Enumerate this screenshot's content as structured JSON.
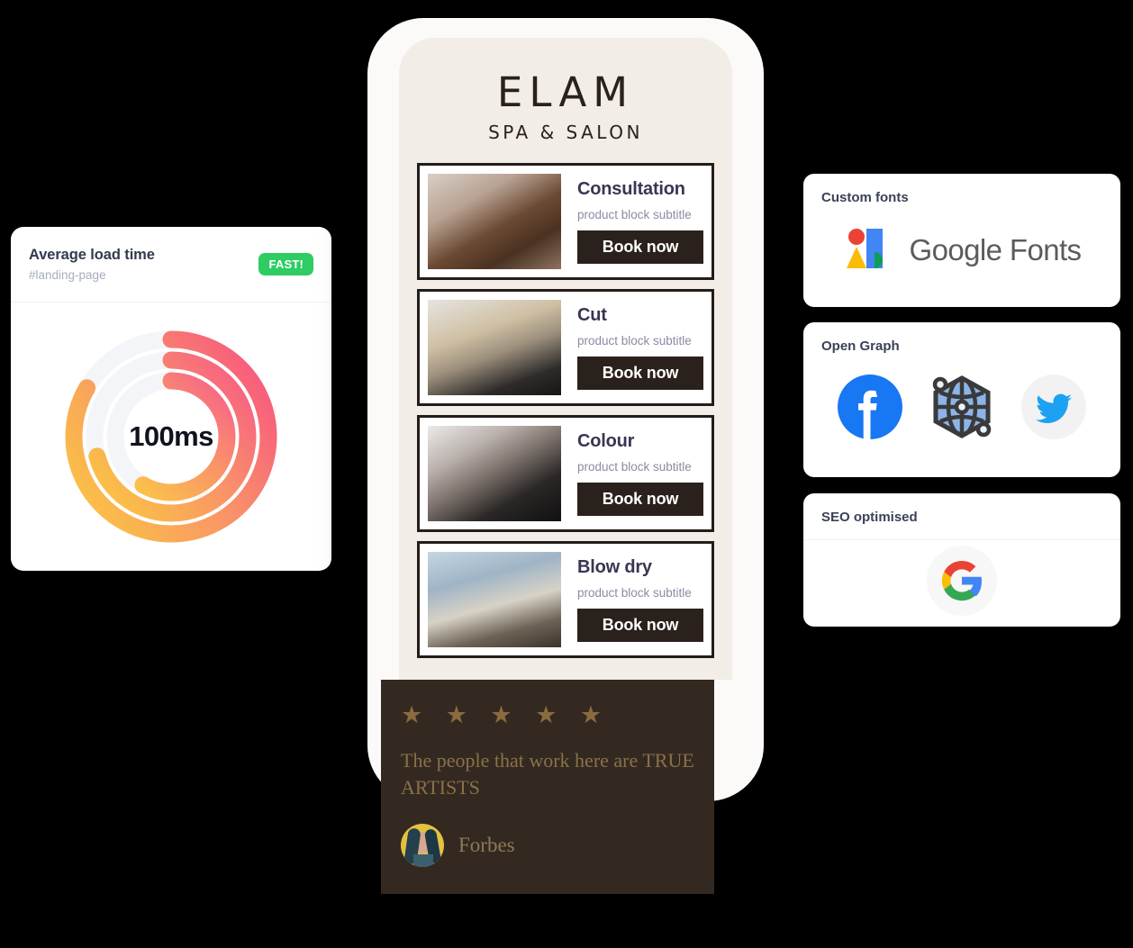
{
  "perf_card": {
    "title": "Average load time",
    "subtitle": "#landing-page",
    "badge": "FAST!",
    "value": "100ms"
  },
  "chart_data": {
    "type": "pie",
    "title": "Average load time",
    "subtitle": "#landing-page",
    "center_label": "100ms",
    "value": 100,
    "unit": "ms",
    "status": "FAST!",
    "rings": [
      {
        "name": "outer",
        "sweep_deg": 300,
        "start_angle_deg": -90,
        "color_start": "#FBC345",
        "color_end": "#F7577F"
      },
      {
        "name": "middle",
        "sweep_deg": 255,
        "start_angle_deg": -90,
        "color_start": "#FBC345",
        "color_end": "#F7577F"
      },
      {
        "name": "inner",
        "sweep_deg": 210,
        "start_angle_deg": -90,
        "color_start": "#FBC345",
        "color_end": "#F7577F"
      }
    ],
    "track_color": "#F4F5F8",
    "legend": "none",
    "grid": false
  },
  "phone": {
    "brand_main": "ELAM",
    "brand_sub": "SPA & SALON",
    "products": [
      {
        "title": "Consultation",
        "subtitle": "product block subtitle",
        "button": "Book now",
        "image": "salon-braiding-photo"
      },
      {
        "title": "Cut",
        "subtitle": "product block subtitle",
        "button": "Book now",
        "image": "salon-cutting-photo"
      },
      {
        "title": "Colour",
        "subtitle": "product block subtitle",
        "button": "Book now",
        "image": "salon-colour-photo"
      },
      {
        "title": "Blow dry",
        "subtitle": "product block subtitle",
        "button": "Book now",
        "image": "salon-interior-photo"
      }
    ],
    "testimonial": {
      "stars": "★ ★ ★ ★ ★",
      "star_count": 5,
      "quote": "The people that work here are TRUE ARTISTS",
      "author": "Forbes"
    }
  },
  "right_cards": [
    {
      "title": "Custom fonts",
      "logo_text": "Google Fonts",
      "logo": "google-fonts-logo"
    },
    {
      "title": "Open Graph",
      "icons": [
        "facebook-icon",
        "open-graph-icon",
        "twitter-icon"
      ]
    },
    {
      "title": "SEO optimised",
      "logo": "google-g-logo"
    }
  ],
  "colors": {
    "accent_start": "#FBC345",
    "accent_end": "#F7577F",
    "badge_green": "#2ECC63",
    "dark_brown": "#2B211C",
    "testimonial_bg": "#332921",
    "screen_bg": "#F2EDE7"
  }
}
